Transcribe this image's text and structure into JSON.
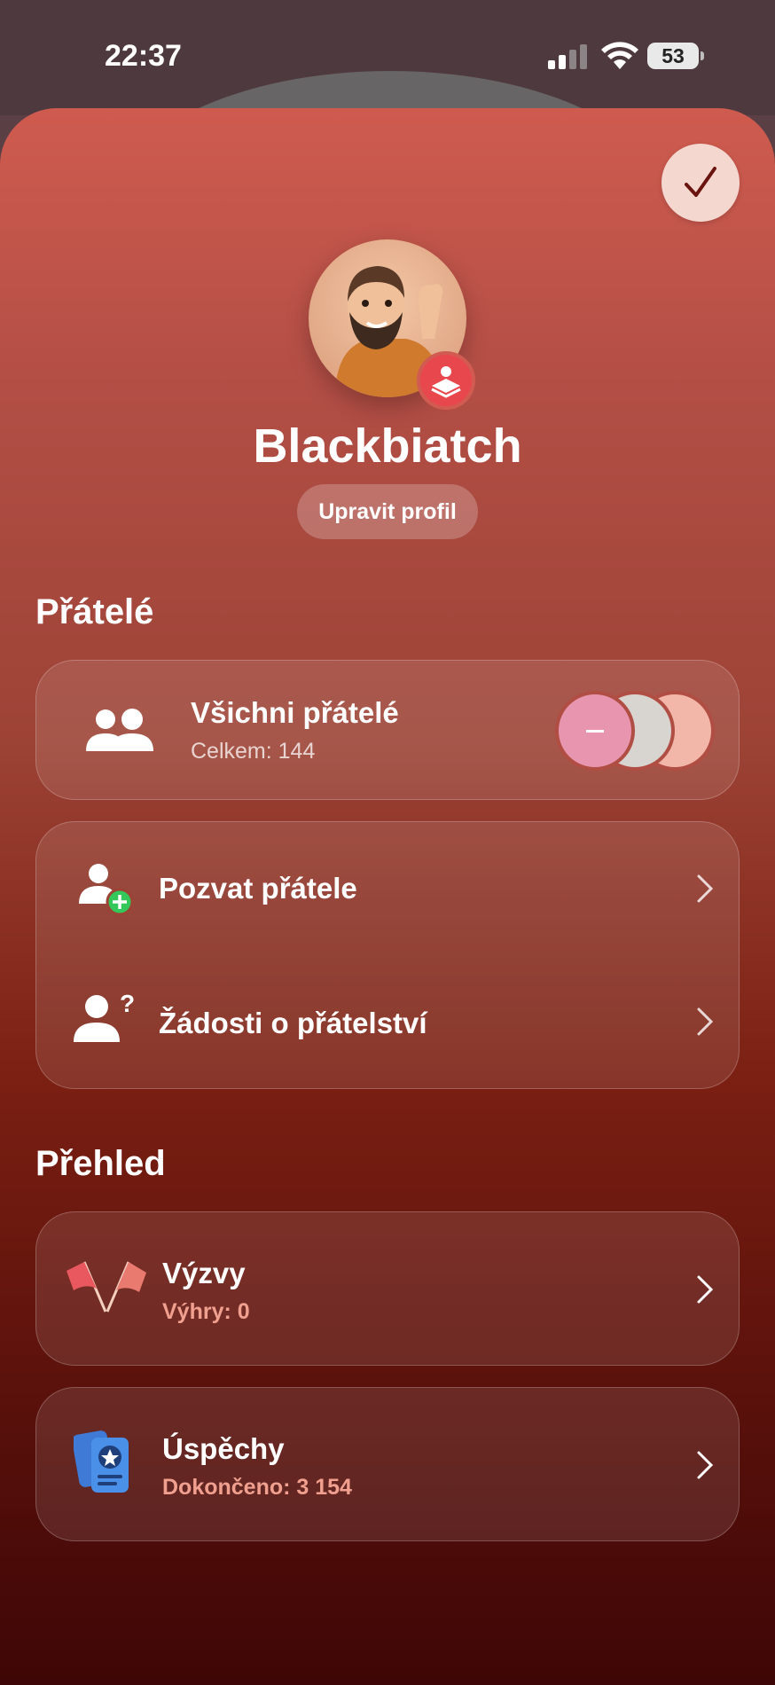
{
  "status_bar": {
    "time": "22:37",
    "battery": "53"
  },
  "profile": {
    "username": "Blackbiatch",
    "edit_label": "Upravit profil"
  },
  "friends": {
    "section_title": "Přátelé",
    "all_friends": {
      "title": "Všichni přátelé",
      "subtitle": "Celkem: 144"
    },
    "invite": {
      "title": "Pozvat přátele"
    },
    "requests": {
      "title": "Žádosti o přátelství"
    }
  },
  "overview": {
    "section_title": "Přehled",
    "challenges": {
      "title": "Výzvy",
      "subtitle": "Výhry: 0"
    },
    "achievements": {
      "title": "Úspěchy",
      "subtitle": "Dokončeno: 3 154"
    }
  },
  "colors": {
    "accent_red": "#e8474d",
    "sheet_top": "#cf5b4f",
    "sheet_bottom": "#3e0606",
    "subtitle_accent": "#f1a08f",
    "plus_green": "#34c759"
  },
  "icons": [
    "signal-icon",
    "wifi-icon",
    "battery-icon",
    "checkmark-icon",
    "game-center-icon",
    "people-icon",
    "person-add-icon",
    "person-question-icon",
    "flags-icon",
    "achievement-cards-icon",
    "chevron-right-icon"
  ]
}
